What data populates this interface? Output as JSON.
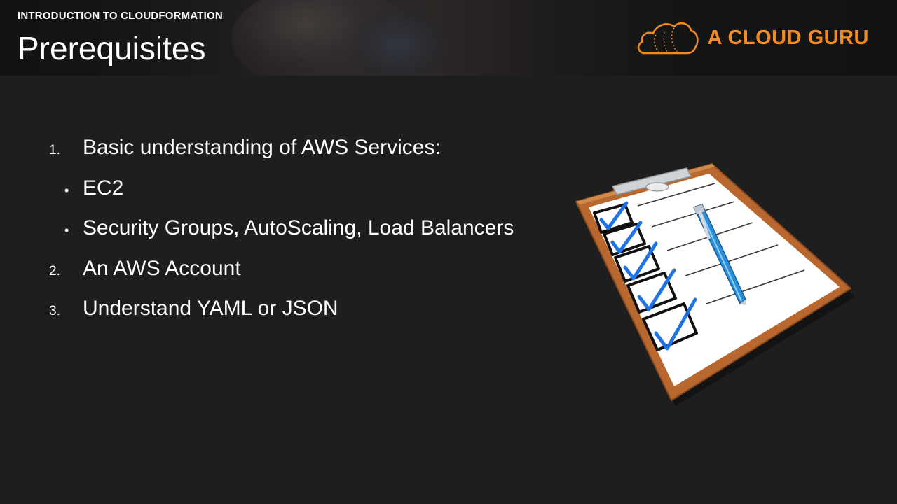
{
  "header": {
    "course_title": "INTRODUCTION TO CLOUDFORMATION",
    "slide_title": "Prerequisites",
    "brand": {
      "name": "A CLOUD GURU",
      "logo_icon": "cloud-logo-icon",
      "color": "#f48a1e"
    }
  },
  "content": {
    "items": [
      {
        "marker": "1.",
        "text": "Basic understanding of AWS Services:"
      },
      {
        "marker": "•",
        "text": "EC2"
      },
      {
        "marker": "•",
        "text": "Security Groups, AutoScaling, Load Balancers"
      },
      {
        "marker": "2.",
        "text": "An AWS Account"
      },
      {
        "marker": "3.",
        "text": "Understand YAML or JSON"
      }
    ]
  },
  "illustration": {
    "icon": "clipboard-checklist-icon",
    "checkmark_color": "#1e73e8",
    "pen_color": "#2a8fd8",
    "board_color": "#b8682e"
  },
  "colors": {
    "background": "#1e1e1e",
    "text": "#ffffff",
    "accent": "#f48a1e"
  }
}
